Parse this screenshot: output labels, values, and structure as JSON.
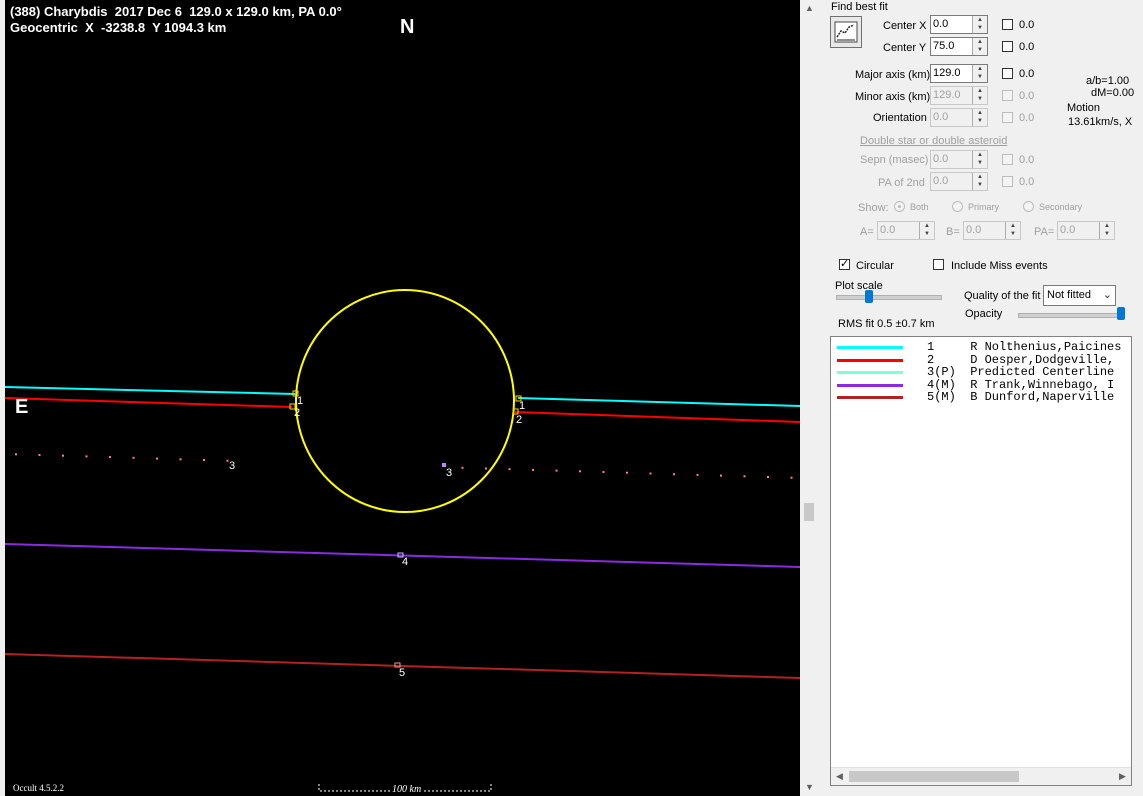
{
  "plot": {
    "title_line1": "(388) Charybdis  2017 Dec 6  129.0 x 129.0 km, PA 0.0°",
    "title_line2": "Geocentric  X  -3238.8  Y 1094.3 km",
    "north": "N",
    "east": "E",
    "version": "Occult 4.5.2.2",
    "scale_label": "100 km",
    "chord_labels": {
      "c1a": "1",
      "c2a": "2",
      "c1b": "1",
      "c2b": "2",
      "c3a": "3",
      "c3b": "3",
      "c4": "4",
      "c5": "5"
    },
    "colors": {
      "background": "#000000",
      "ellipse": "#ffff00",
      "chord1": "#00ffff",
      "chord2": "#ff0000",
      "chord3": "#ff8080",
      "chord4": "#8a2be2",
      "chord5": "#b22222"
    }
  },
  "panel": {
    "find_best_fit": "Find best fit",
    "fit_icon": "graph-fit-icon",
    "center_x": {
      "label": "Center X",
      "value": "0.0",
      "check_value": "0.0"
    },
    "center_y": {
      "label": "Center Y",
      "value": "75.0",
      "check_value": "0.0"
    },
    "major_axis": {
      "label": "Major axis (km)",
      "value": "129.0",
      "check_value": "0.0"
    },
    "minor_axis": {
      "label": "Minor axis (km)",
      "value": "129.0",
      "check_value": "0.0"
    },
    "orientation": {
      "label": "Orientation",
      "value": "0.0",
      "check_value": "0.0"
    },
    "ab_ratio": "a/b=1.00",
    "dm": "dM=0.00",
    "motion_label": "Motion",
    "motion_value": "13.61km/s, X",
    "double_star_link": "Double star  or  double asteroid",
    "sepn": {
      "label": "Sepn (masec)",
      "value": "0.0",
      "check_value": "0.0"
    },
    "pa2nd": {
      "label": "PA of 2nd",
      "value": "0.0",
      "check_value": "0.0"
    },
    "show_label": "Show:",
    "show_options": [
      "Both",
      "Primary",
      "Secondary"
    ],
    "a_label": "A=",
    "a_value": "0.0",
    "b_label": "B=",
    "b_value": "0.0",
    "pa_label": "PA=",
    "pa_value": "0.0",
    "circular_label": "Circular",
    "circular_checked": true,
    "miss_label": "Include Miss events",
    "miss_checked": false,
    "plot_scale_label": "Plot scale",
    "quality_label": "Quality of the fit",
    "quality_value": "Not fitted",
    "opacity_label": "Opacity",
    "rms_fit": "RMS fit 0.5 ±0.7 km"
  },
  "legend": [
    {
      "text": "1     R Nolthenius,Paicines",
      "color": "#00ffff"
    },
    {
      "text": "2     D Oesper,Dodgeville,",
      "color": "#ff0000"
    },
    {
      "text": "3(P)  Predicted Centerline",
      "color": "#7fffd4"
    },
    {
      "text": "4(M)  R Trank,Winnebago, I",
      "color": "#8a2be2"
    },
    {
      "text": "5(M)  B Dunford,Naperville",
      "color": "#b22222"
    }
  ]
}
